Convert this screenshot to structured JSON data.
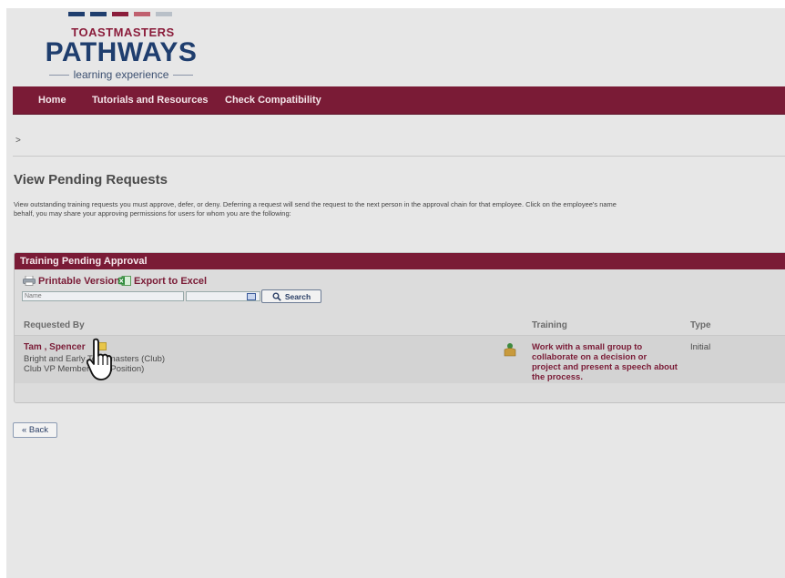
{
  "header": {
    "logo_top": "TOASTMASTERS",
    "logo_main": "PATHWAYS",
    "logo_sub": "learning experience",
    "logo_bar_colors": [
      "#1f3e6e",
      "#1f3e6e",
      "#8b1d3b",
      "#c0606f",
      "#b9c0c8"
    ]
  },
  "nav": {
    "items": [
      {
        "label": "Home"
      },
      {
        "label": "Tutorials and Resources"
      },
      {
        "label": "Check Compatibility"
      }
    ]
  },
  "breadcrumb": ">",
  "page": {
    "title": "View Pending Requests",
    "intro_line1": "View outstanding training requests you must approve, defer, or deny. Deferring a request will send the request to the next person in the approval chain for that employee. Click on the employee's name",
    "intro_line2": "behalf, you may share your approving permissions for users for whom you are the following:"
  },
  "panel": {
    "title": "Training Pending Approval",
    "toolbar": {
      "print_label": "Printable Version",
      "export_label": "Export to Excel"
    },
    "filter": {
      "name_placeholder": "Name",
      "search_label": "Search"
    },
    "columns": [
      "Requested By",
      "Training",
      "Type"
    ],
    "rows": [
      {
        "name": "Tam , Spencer",
        "club": "Bright and Early Toastmasters (Club)",
        "position": "Club VP Membership (Position)",
        "training": "Work with a small group to collaborate on a decision or project and present a speech about the process.",
        "type": "Initial"
      }
    ]
  },
  "back_label": "« Back",
  "colors": {
    "brand": "#7a1b36",
    "navy": "#1f3e6e"
  },
  "icons": [
    "printer-icon",
    "excel-icon",
    "calendar-icon",
    "magnifier-icon",
    "edit-icon",
    "training-icon",
    "hand-cursor-icon"
  ]
}
